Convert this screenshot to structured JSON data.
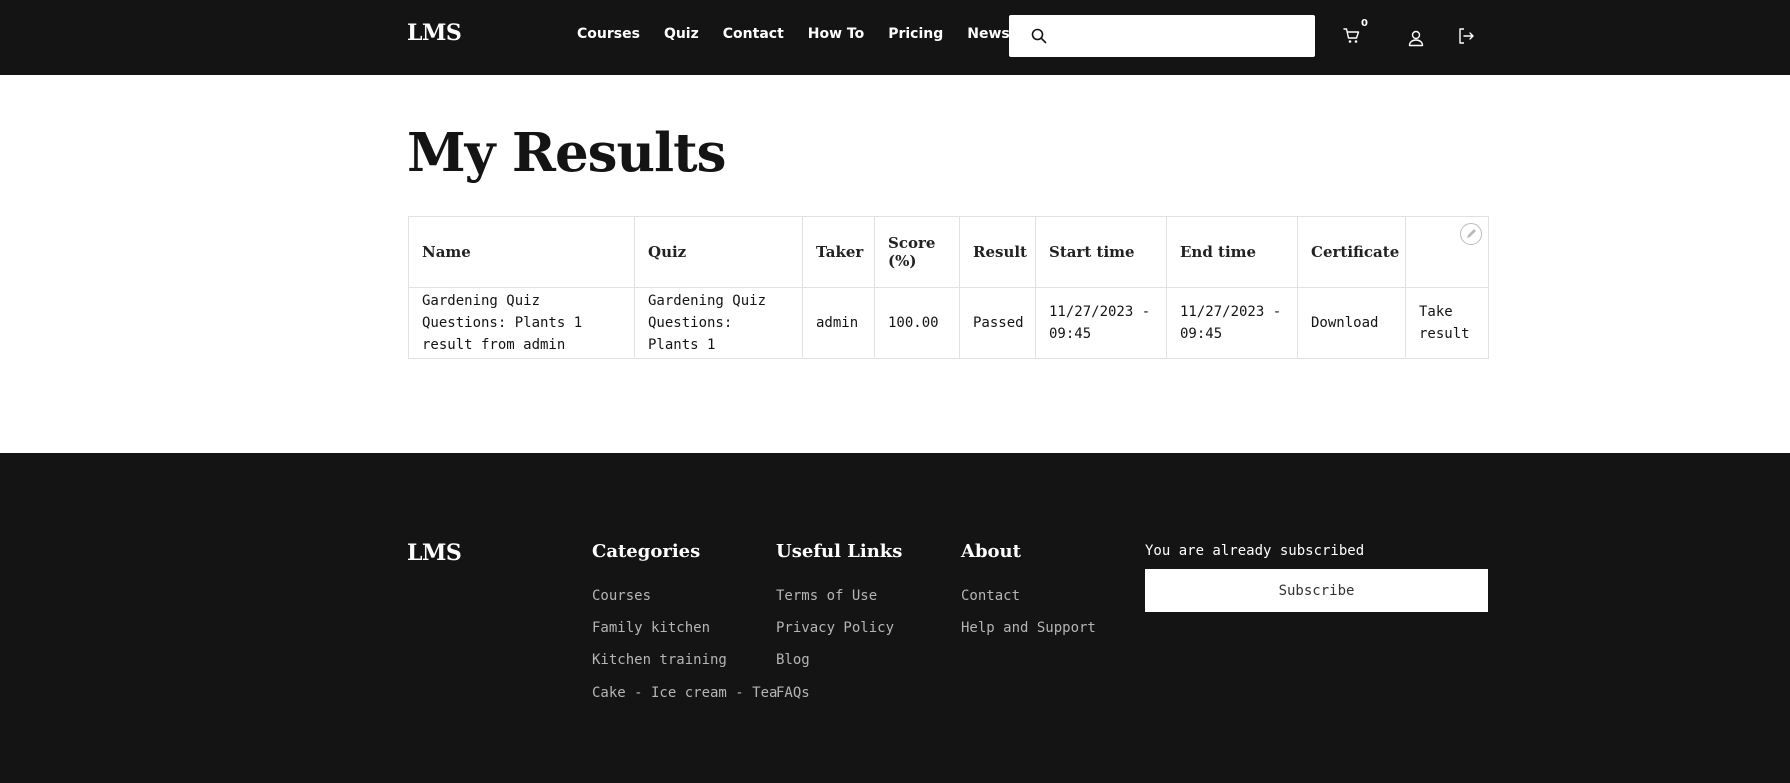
{
  "header": {
    "logo": "LMS",
    "nav": [
      "Courses",
      "Quiz",
      "Contact",
      "How To",
      "Pricing",
      "News"
    ],
    "search_placeholder": "",
    "cart_count": "0",
    "icons": [
      "search-icon",
      "cart-icon",
      "user-icon",
      "logout-icon"
    ]
  },
  "main": {
    "title": "My Results",
    "table": {
      "headers": [
        "Name",
        "Quiz",
        "Taker",
        "Score (%)",
        "Result",
        "Start time",
        "End time",
        "Certificate",
        ""
      ],
      "rows": [
        {
          "name": "Gardening Quiz Questions: Plants 1 result from admin",
          "quiz": "Gardening Quiz Questions: Plants 1",
          "taker": "admin",
          "score": "100.00",
          "result": "Passed",
          "start": "11/27/2023 - 09:45",
          "end": "11/27/2023 - 09:45",
          "certificate": "Download",
          "action": "Take result"
        }
      ]
    }
  },
  "footer": {
    "logo": "LMS",
    "categories": {
      "title": "Categories",
      "links": [
        "Courses",
        "Family kitchen",
        "Kitchen training",
        "Cake - Ice cream - Tea"
      ]
    },
    "useful_links": {
      "title": "Useful Links",
      "links": [
        "Terms of Use",
        "Privacy Policy",
        "Blog",
        "FAQs"
      ]
    },
    "about": {
      "title": "About",
      "links": [
        "Contact",
        "Help and Support"
      ]
    },
    "newsletter": {
      "status": "You are already subscribed",
      "button": "Subscribe"
    }
  },
  "colors": {
    "dark": "#141414",
    "border": "#e1e1e1",
    "link_muted": "#b5b5b5"
  }
}
